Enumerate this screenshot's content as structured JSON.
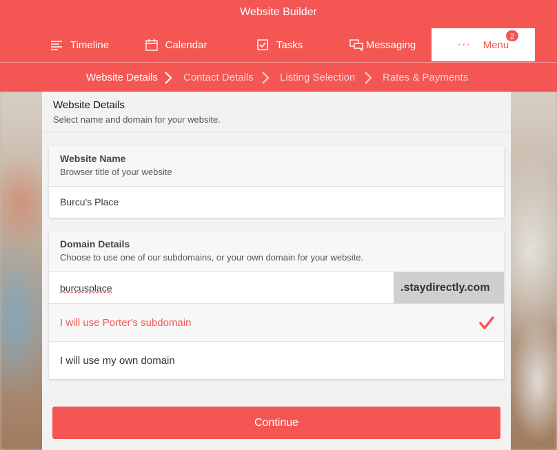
{
  "app": {
    "title": "Website Builder"
  },
  "nav": {
    "timeline": "Timeline",
    "calendar": "Calendar",
    "tasks": "Tasks",
    "messaging": "Messaging",
    "menu": "Menu",
    "menu_badge": "2"
  },
  "breadcrumb": {
    "step1": "Website Details",
    "step2": "Contact Details",
    "step3": "Listing Selection",
    "step4": "Rates & Payments"
  },
  "panel": {
    "title": "Website Details",
    "subtitle": "Select name and domain for your website."
  },
  "website_name": {
    "title": "Website Name",
    "subtitle": "Browser title of your website",
    "value": "Burcu's Place"
  },
  "domain": {
    "title": "Domain Details",
    "subtitle": "Choose to use one of our subdomains, or your own domain for your website.",
    "value": "burcusplace",
    "suffix": ".staydirectly.com",
    "option_subdomain": "I will use Porter's subdomain",
    "option_own": "I will use my own domain"
  },
  "actions": {
    "continue": "Continue"
  },
  "colors": {
    "accent": "#f45753"
  }
}
